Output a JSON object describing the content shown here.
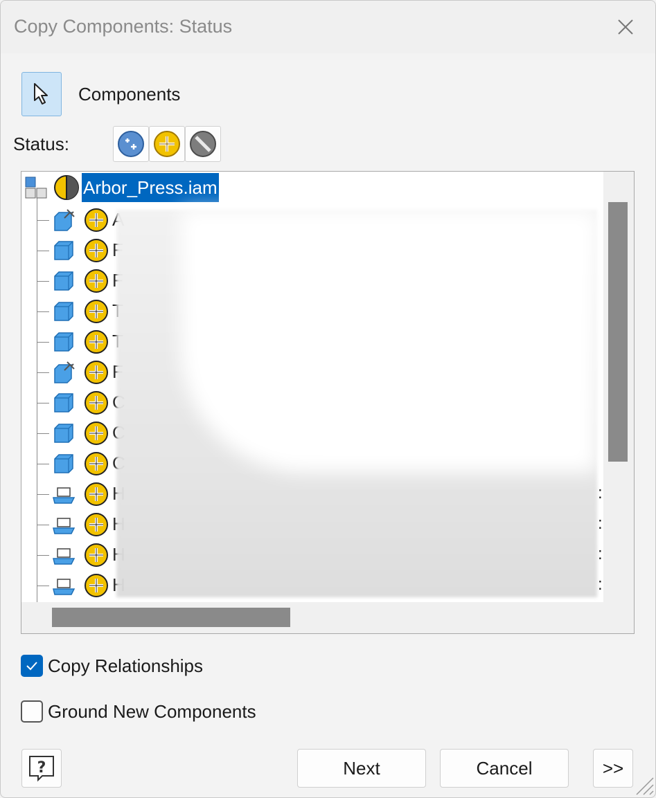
{
  "window": {
    "title": "Copy Components: Status"
  },
  "toolbar": {
    "components_label": "Components",
    "status_label": "Status:"
  },
  "status_icons": [
    "copy-status-icon",
    "reuse-status-icon",
    "exclude-status-icon"
  ],
  "tree": {
    "root": {
      "label": "Arbor_Press.iam",
      "type": "assembly-icon",
      "status": "mixed-status-icon"
    },
    "children": [
      {
        "label": "A",
        "type": "subassembly-pinned-icon",
        "status": "reuse-status-icon"
      },
      {
        "label": "F",
        "type": "part-icon",
        "status": "reuse-status-icon"
      },
      {
        "label": "F",
        "type": "part-icon",
        "status": "reuse-status-icon"
      },
      {
        "label": "T",
        "type": "part-icon",
        "status": "reuse-status-icon"
      },
      {
        "label": "T",
        "type": "part-icon",
        "status": "reuse-status-icon"
      },
      {
        "label": "F",
        "type": "subassembly-pinned-icon",
        "status": "reuse-status-icon"
      },
      {
        "label": "C",
        "type": "part-icon",
        "status": "reuse-status-icon"
      },
      {
        "label": "C",
        "type": "part-icon",
        "status": "reuse-status-icon"
      },
      {
        "label": "C",
        "type": "part-icon",
        "status": "reuse-status-icon"
      },
      {
        "label": "H",
        "type": "content-center-part-icon",
        "status": "reuse-status-icon",
        "suffix": ":"
      },
      {
        "label": "H",
        "type": "content-center-part-icon",
        "status": "reuse-status-icon",
        "suffix": ":"
      },
      {
        "label": "H",
        "type": "content-center-part-icon",
        "status": "reuse-status-icon",
        "suffix": ":"
      },
      {
        "label": "H",
        "type": "content-center-part-icon",
        "status": "reuse-status-icon",
        "suffix": ":"
      }
    ]
  },
  "options": {
    "copy_relationships": {
      "label": "Copy Relationships",
      "checked": true
    },
    "ground_new_components": {
      "label": "Ground New Components",
      "checked": false
    }
  },
  "buttons": {
    "next": "Next",
    "cancel": "Cancel",
    "expand": ">>"
  },
  "colors": {
    "accent": "#0067c0",
    "scrollbar": "#8a8a8a",
    "select_button": "#cde5f8"
  }
}
